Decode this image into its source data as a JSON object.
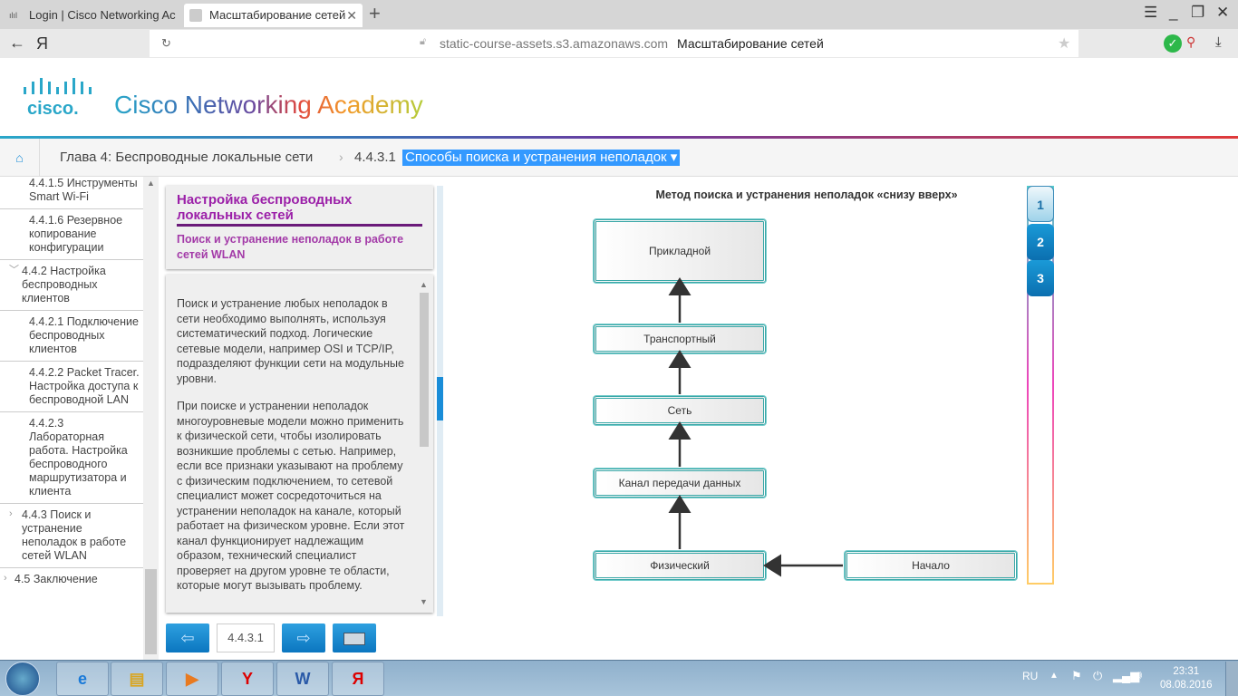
{
  "browser": {
    "tabs": [
      {
        "label": "Login | Cisco Networking Ac",
        "icon": "cisco-icon"
      },
      {
        "label": "Масштабирование сетей",
        "icon": "page-icon",
        "active": true
      }
    ],
    "url": "static-course-assets.s3.amazonaws.com",
    "page_title": "Масштабирование сетей",
    "yandex": "Я"
  },
  "header": {
    "logo_word": "cisco.",
    "brand": "Cisco Networking Academy"
  },
  "breadcrumb": {
    "chapter": "Глава 4: Беспроводные локальные сети",
    "section_num": "4.4.3.1",
    "section": "Способы поиска и устранения неполадок ▾"
  },
  "sidebar": {
    "items": [
      {
        "label": "4.4.1.5 Инструменты Smart Wi-Fi",
        "level": 3
      },
      {
        "label": "4.4.1.6 Резервное копирование конфигурации",
        "level": 3
      },
      {
        "label": "4.4.2 Настройка беспроводных клиентов",
        "level": 2,
        "chevron": "﹀"
      },
      {
        "label": "4.4.2.1 Подключение беспроводных клиентов",
        "level": 3
      },
      {
        "label": "4.4.2.2 Packet Tracer. Настройка доступа к беспроводной LAN",
        "level": 3
      },
      {
        "label": "4.4.2.3 Лабораторная работа. Настройка беспроводного маршрутизатора и клиента",
        "level": 3
      },
      {
        "label": "4.4.3 Поиск и устранение неполадок в работе сетей WLAN",
        "level": 2,
        "chevron": "›"
      },
      {
        "label": "4.5 Заключение",
        "level": 1,
        "chevron": "›"
      }
    ]
  },
  "panel": {
    "title": "Настройка беспроводных локальных сетей",
    "subtitle": "Поиск и устранение неполадок в работе сетей WLAN",
    "paragraphs": [
      "Поиск и устранение любых неполадок в сети необходимо выполнять, используя систематический подход. Логические сетевые модели, например OSI и TCP/IP, подразделяют функции сети на модульные уровни.",
      "При поиске и устранении неполадок многоуровневые модели можно применить к физической сети, чтобы изолировать возникшие проблемы с сетью. Например, если все признаки указывают на проблему с физическим подключением, то сетевой специалист может сосредоточиться на устранении неполадок на канале, который работает на физическом уровне. Если этот канал функционирует надлежащим образом, технический специалист проверяет на другом уровне те области, которые могут вызывать проблему."
    ]
  },
  "nav": {
    "page": "4.4.3.1"
  },
  "diagram": {
    "title": "Метод поиска и устранения неполадок «снизу вверх»",
    "layers": [
      "Прикладной",
      "Транспортный",
      "Сеть",
      "Канал передачи данных",
      "Физический"
    ],
    "start": "Начало"
  },
  "steps": [
    "1",
    "2",
    "3"
  ],
  "active_step": "1",
  "taskbar": {
    "lang": "RU",
    "time": "23:31",
    "date": "08.08.2016"
  },
  "colors": {
    "accent": "#1a8dd8",
    "title": "#9b1fa8",
    "layer_border": "#39a7a7"
  }
}
